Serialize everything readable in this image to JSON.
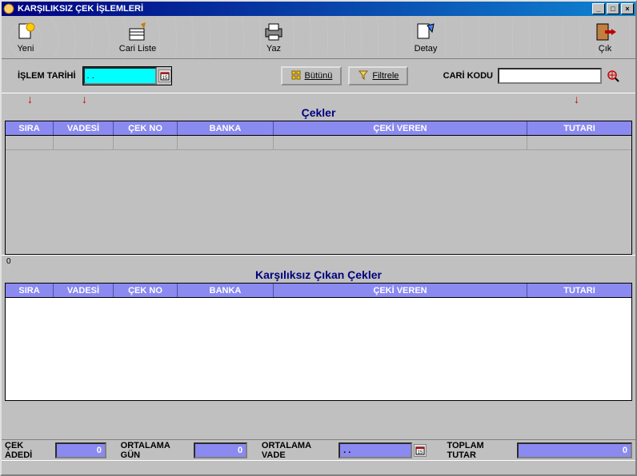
{
  "window": {
    "title": "KARŞILIKSIZ ÇEK İŞLEMLERİ"
  },
  "toolbar": {
    "yeni": "Yeni",
    "cari_liste": "Cari Liste",
    "yaz": "Yaz",
    "detay": "Detay",
    "cik": "Çık"
  },
  "filters": {
    "islem_tarihi_label": "İŞLEM TARİHİ",
    "islem_tarihi_value": ". .",
    "butunu_label": "Bütünü",
    "filtrele_label": "Filtrele",
    "cari_kodu_label": "CARİ KODU",
    "cari_kodu_value": ""
  },
  "section1": {
    "title": "Çekler",
    "headers": [
      "SIRA",
      "VADESİ",
      "ÇEK NO",
      "BANKA",
      "ÇEKİ VEREN",
      "TUTARI"
    ]
  },
  "section2": {
    "zero": "0",
    "title": "Karşılıksız Çıkan Çekler",
    "headers": [
      "SIRA",
      "VADESİ",
      "ÇEK NO",
      "BANKA",
      "ÇEKİ VEREN",
      "TUTARI"
    ]
  },
  "footer": {
    "cek_adedi_label": "ÇEK ADEDİ",
    "cek_adedi_value": "0",
    "ortalama_gun_label": "ORTALAMA GÜN",
    "ortalama_gun_value": "0",
    "ortalama_vade_label": "ORTALAMA VADE",
    "ortalama_vade_value": ". .",
    "toplam_tutar_label": "TOPLAM TUTAR",
    "toplam_tutar_value": "0"
  }
}
